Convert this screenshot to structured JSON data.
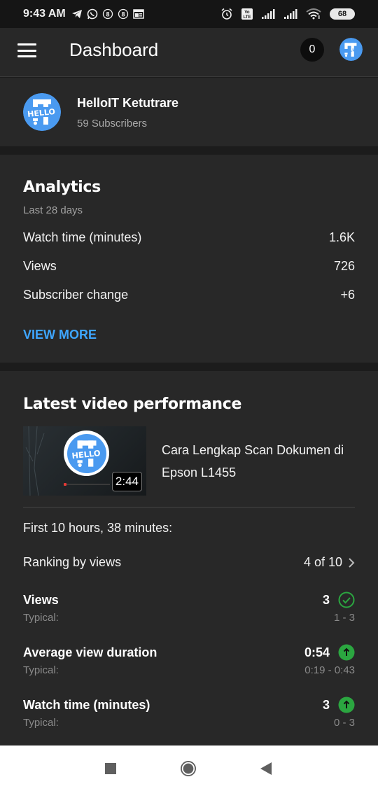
{
  "status_bar": {
    "time": "9:43 AM",
    "left_icons": [
      "telegram-icon",
      "whatsapp-icon",
      "notification-8-icon",
      "notification-8-icon",
      "news-icon"
    ],
    "right_icons": [
      "alarm-icon",
      "volte-icon",
      "signal-icon",
      "signal-icon",
      "wifi-icon"
    ],
    "battery": "68"
  },
  "app_bar": {
    "title": "Dashboard",
    "notification_count": "0"
  },
  "channel": {
    "name": "HelloIT Ketutrare",
    "subscribers": "59 Subscribers"
  },
  "analytics": {
    "title": "Analytics",
    "period": "Last 28 days",
    "rows": [
      {
        "label": "Watch time (minutes)",
        "value": "1.6K"
      },
      {
        "label": "Views",
        "value": "726"
      },
      {
        "label": "Subscriber change",
        "value": "+6"
      }
    ],
    "view_more": "VIEW MORE"
  },
  "latest_video": {
    "title": "Latest video performance",
    "video_title": "Cara Lengkap Scan Dokumen di Epson L1455",
    "duration": "2:44",
    "period_label": "First 10 hours, 38 minutes:",
    "ranking_label": "Ranking by views",
    "ranking_value": "4 of 10",
    "metrics": [
      {
        "label": "Views",
        "value": "3",
        "status": "within-typical",
        "typical_label": "Typical:",
        "typical_range": "1 - 3"
      },
      {
        "label": "Average view duration",
        "value": "0:54",
        "status": "above-typical",
        "typical_label": "Typical:",
        "typical_range": "0:19 - 0:43"
      },
      {
        "label": "Watch time (minutes)",
        "value": "3",
        "status": "above-typical",
        "typical_label": "Typical:",
        "typical_range": "0 - 3"
      }
    ]
  },
  "colors": {
    "accent_link": "#3ea6ff",
    "status_green": "#2ba640",
    "brand_blue": "#4a9af0"
  }
}
